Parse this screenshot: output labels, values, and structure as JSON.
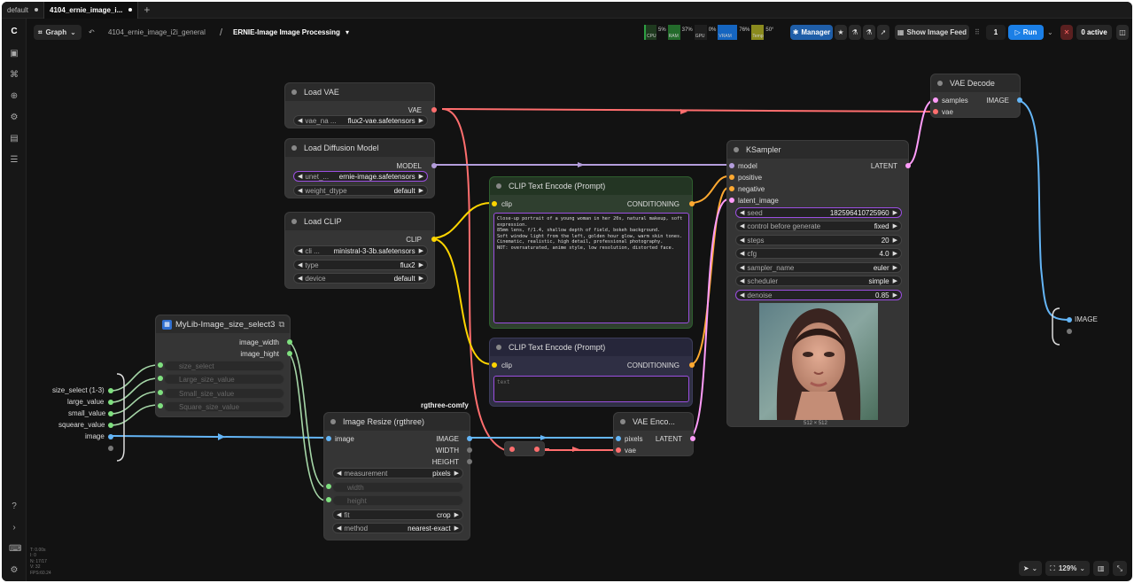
{
  "tabs": [
    {
      "label": "default",
      "active": false
    },
    {
      "label": "4104_ernie_image_i...",
      "active": true
    }
  ],
  "toolbar": {
    "graph_label": "Graph",
    "breadcrumb": "4104_ernie_image_i2i_general",
    "separator": "/",
    "workflow_title": "ERNIE-Image Image Processing",
    "meters": [
      {
        "label": "CPU",
        "value": "5%"
      },
      {
        "label": "RAM",
        "value": "37%"
      },
      {
        "label": "GPU",
        "value": "0%"
      },
      {
        "label": "VRAM",
        "value": "76%"
      },
      {
        "label": "Temp",
        "value": "50°"
      }
    ],
    "manager_label": "Manager",
    "show_feed_label": "Show Image Feed",
    "queue_count": "1",
    "run_label": "Run",
    "active_label": "0 active"
  },
  "nodes": {
    "load_vae": {
      "title": "Load VAE",
      "out": "VAE",
      "widget_label": "vae_na ...",
      "widget_value": "flux2-vae.safetensors"
    },
    "load_diffusion": {
      "title": "Load Diffusion Model",
      "out": "MODEL",
      "w1_label": "unet_...",
      "w1_value": "ernie-image.safetensors",
      "w2_label": "weight_dtype",
      "w2_value": "default"
    },
    "load_clip": {
      "title": "Load CLIP",
      "out": "CLIP",
      "w1_label": "cli ...",
      "w1_value": "ministral-3-3b.safetensors",
      "w2_label": "type",
      "w2_value": "flux2",
      "w3_label": "device",
      "w3_value": "default"
    },
    "clip_pos": {
      "title": "CLIP Text Encode (Prompt)",
      "in": "clip",
      "out": "CONDITIONING",
      "text": "Close-up portrait of a young woman in her 20s, natural makeup, soft expression.\n85mm lens, f/1.4, shallow depth of field, bokeh background.\nSoft window light from the left, golden hour glow, warm skin tones.\nCinematic, realistic, high detail, professional photography.\nNOT: oversaturated, anime style, low resolution, distorted face."
    },
    "clip_neg": {
      "title": "CLIP Text Encode (Prompt)",
      "in": "clip",
      "out": "CONDITIONING",
      "text": "text"
    },
    "ksampler": {
      "title": "KSampler",
      "inputs": [
        "model",
        "positive",
        "negative",
        "latent_image"
      ],
      "out": "LATENT",
      "widgets": [
        {
          "label": "seed",
          "value": "182596410725960"
        },
        {
          "label": "control before generate",
          "value": "fixed"
        },
        {
          "label": "steps",
          "value": "20"
        },
        {
          "label": "cfg",
          "value": "4.0"
        },
        {
          "label": "sampler_name",
          "value": "euler"
        },
        {
          "label": "scheduler",
          "value": "simple"
        },
        {
          "label": "denoise",
          "value": "0.85"
        }
      ],
      "image_size": "512 × 512"
    },
    "vae_decode": {
      "title": "VAE Decode",
      "in1": "samples",
      "in2": "vae",
      "out": "IMAGE"
    },
    "size_select": {
      "title": "MyLib-Image_size_select3",
      "out1": "image_width",
      "out2": "image_hight",
      "widgets": [
        "size_select",
        "Large_size_value",
        "Small_size_value",
        "Square_size_value"
      ]
    },
    "image_resize": {
      "title": "Image Resize (rgthree)",
      "badge": "rgthree-comfy",
      "in": "image",
      "outs": [
        "IMAGE",
        "WIDTH",
        "HEIGHT"
      ],
      "w_measure_label": "measurement",
      "w_measure_value": "pixels",
      "w_width": "width",
      "w_height": "height",
      "w_fit_label": "fit",
      "w_fit_value": "crop",
      "w_method_label": "method",
      "w_method_value": "nearest-exact"
    },
    "vae_encode": {
      "title": "VAE Enco...",
      "in1": "pixels",
      "in2": "vae",
      "out": "LATENT"
    }
  },
  "group_inputs": [
    "size_select (1-3)",
    "large_value",
    "small_value",
    "squeare_value",
    "image"
  ],
  "output_label": "IMAGE",
  "bottom": {
    "zoom": "129%"
  },
  "stats": "T: 0.00s\nI: 0\nN: 17/17\nV: 32\nFPS:60.24",
  "colors": {
    "vae": "#ff6e6e",
    "model": "#b39ddb",
    "clip": "#ffd500",
    "conditioning": "#ffa931",
    "latent": "#ff9cf9",
    "image": "#64b5f6",
    "int": "#7fe07f"
  }
}
